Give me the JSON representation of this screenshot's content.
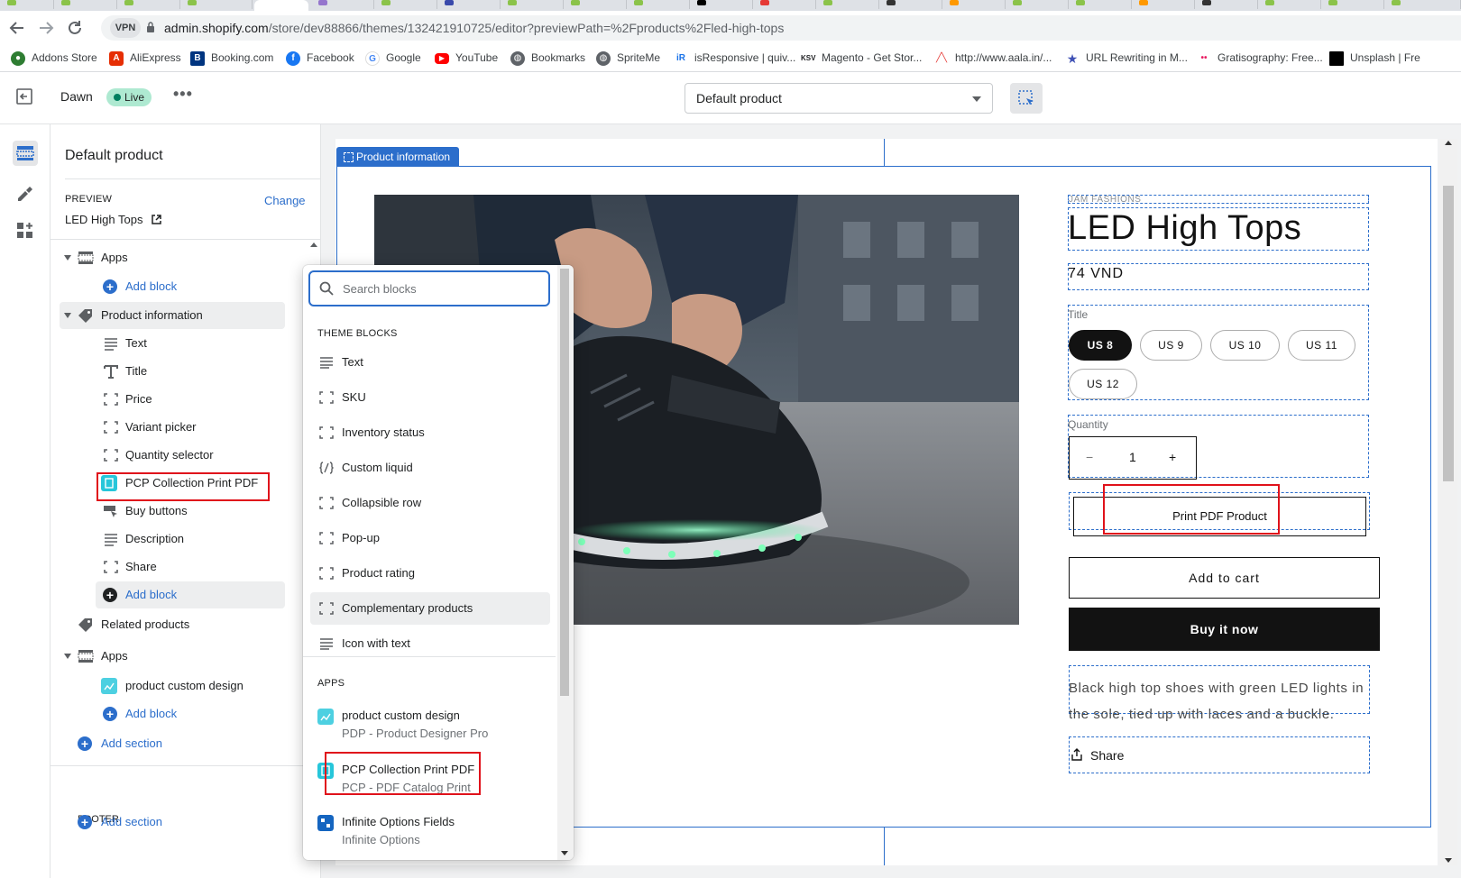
{
  "browser": {
    "url_host": "admin.shopify.com",
    "url_path": "/store/dev88866/themes/132421910725/editor?previewPath=%2Fproducts%2Fled-high-tops",
    "vpn_label": "VPN",
    "bookmarks": [
      {
        "label": "Addons Store",
        "icon": "addons-icon",
        "color": "#2e7d32"
      },
      {
        "label": "AliExpress",
        "icon": "aliexpress-icon",
        "color": "#e62e04"
      },
      {
        "label": "Booking.com",
        "icon": "booking-icon",
        "color": "#003580"
      },
      {
        "label": "Facebook",
        "icon": "facebook-icon",
        "color": "#1877f2"
      },
      {
        "label": "Google",
        "icon": "google-icon",
        "color": "#4285f4"
      },
      {
        "label": "YouTube",
        "icon": "youtube-icon",
        "color": "#ff0000"
      },
      {
        "label": "Bookmarks",
        "icon": "globe-icon",
        "color": "#5f6368"
      },
      {
        "label": "SpriteMe",
        "icon": "globe-icon",
        "color": "#5f6368"
      },
      {
        "label": "isResponsive | quiv...",
        "icon": "isresponsive-icon",
        "color": "#1a73e8"
      },
      {
        "label": "Magento - Get Stor...",
        "icon": "ksv-icon",
        "color": "#202124"
      },
      {
        "label": "http://www.aala.in/...",
        "icon": "aala-icon",
        "color": "#e53935"
      },
      {
        "label": "URL Rewriting in M...",
        "icon": "star-icon",
        "color": "#3f51b5"
      },
      {
        "label": "Gratisography: Free...",
        "icon": "gratisography-icon",
        "color": "#e91e63"
      },
      {
        "label": "Unsplash | Fre",
        "icon": "unsplash-icon",
        "color": "#000000"
      }
    ]
  },
  "topbar": {
    "theme_name": "Dawn",
    "live_badge": "Live",
    "more": "•••",
    "template_select": "Default product"
  },
  "sidebar": {
    "title": "Default product",
    "preview_label": "PREVIEW",
    "preview_change": "Change",
    "preview_value": "LED High Tops",
    "tree": {
      "apps_top": "Apps",
      "add_block_1": "Add block",
      "product_information": "Product information",
      "blocks": [
        "Text",
        "Title",
        "Price",
        "Variant picker",
        "Quantity selector",
        "PCP Collection Print PDF",
        "Buy buttons",
        "Description",
        "Share"
      ],
      "add_block_2": "Add block",
      "related_products": "Related products",
      "apps_bottom": "Apps",
      "product_custom_design": "product custom design",
      "add_block_3": "Add block",
      "add_section_1": "Add section"
    },
    "footer_label": "FOOTER",
    "add_section_2": "Add section"
  },
  "popover": {
    "search_placeholder": "Search blocks",
    "theme_heading": "THEME BLOCKS",
    "theme_blocks": [
      "Text",
      "SKU",
      "Inventory status",
      "Custom liquid",
      "Collapsible row",
      "Pop-up",
      "Product rating",
      "Complementary products",
      "Icon with text"
    ],
    "apps_heading": "APPS",
    "apps": [
      {
        "name": "product custom design",
        "provider": "PDP - Product Designer Pro",
        "color": "#4dd0e1"
      },
      {
        "name": "PCP Collection Print PDF",
        "provider": "PCP - PDF Catalog Print",
        "color": "#26c6da"
      },
      {
        "name": "Infinite Options Fields",
        "provider": "Infinite Options",
        "color": "#1565c0"
      }
    ]
  },
  "preview": {
    "section_tag": "Product information",
    "vendor": "JAM FASHIONS",
    "product_title": "LED High Tops",
    "price": "74 VND",
    "option_label": "Title",
    "options": [
      "US 8",
      "US 9",
      "US 10",
      "US 11",
      "US 12"
    ],
    "selected_option": "US 8",
    "quantity_label": "Quantity",
    "quantity_minus": "−",
    "quantity_value": "1",
    "quantity_plus": "+",
    "print_pdf_button": "Print PDF Product",
    "add_to_cart": "Add to cart",
    "buy_it_now": "Buy it now",
    "description": "Black high top shoes with green LED lights in the sole, tied up with laces and a buckle.",
    "share": "Share"
  },
  "colors": {
    "accent": "#2c6ecb",
    "highlight_box": "#e0121b",
    "live_badge": "#aee9d1"
  }
}
